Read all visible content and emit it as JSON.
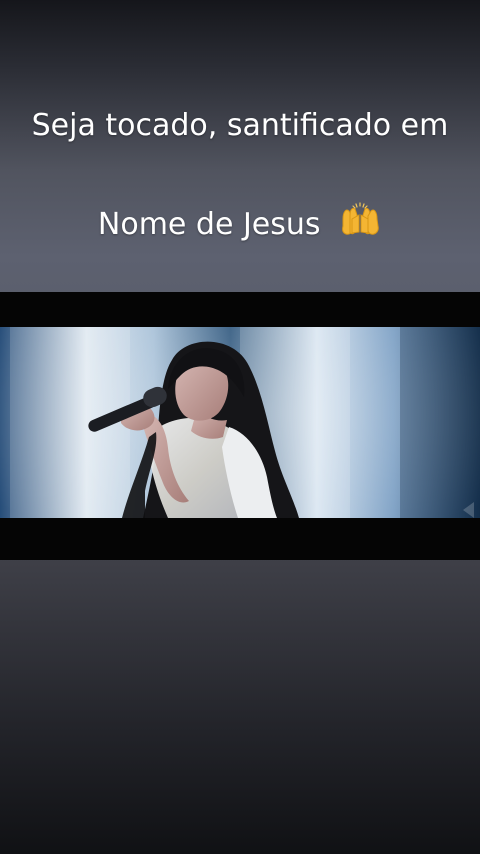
{
  "caption": {
    "line1": "Seja tocado, santificado em",
    "line2": "Nome de Jesus",
    "emoji": "raising-hands-icon"
  },
  "video": {
    "subject": "singer-with-microphone"
  },
  "colors": {
    "background_top": "#15161b",
    "background_mid": "#5d6170",
    "background_bottom": "#101114",
    "caption_text": "#ffffff",
    "letterbox": "#050505"
  }
}
